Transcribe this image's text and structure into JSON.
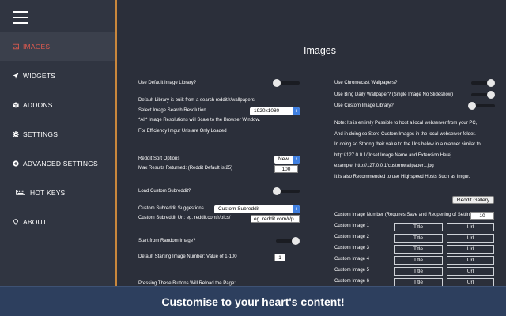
{
  "sidebar": {
    "items": [
      {
        "label": "IMAGES",
        "icon": "image-icon",
        "active": true
      },
      {
        "label": "WIDGETS",
        "icon": "paper-plane-icon"
      },
      {
        "label": "ADDONS",
        "icon": "cube-icon"
      },
      {
        "label": "SETTINGS",
        "icon": "gear-icon"
      },
      {
        "label": "ADVANCED SETTINGS",
        "icon": "plus-circle-icon"
      },
      {
        "label": "HOT KEYS",
        "icon": "keyboard-icon"
      },
      {
        "label": "ABOUT",
        "icon": "lightbulb-icon"
      }
    ]
  },
  "main": {
    "title": "Images",
    "left": {
      "default_library_label": "Use Default Image Library?",
      "default_library_on": false,
      "library_note": "Default Library is built from a search reddit/r/wallpapers",
      "resolution_label": "Select Image Search Resolution",
      "resolution_value": "1920x1080",
      "all_res_note": "*All* Image Resolutions will Scale to the Browser Window.",
      "imgur_note": "For Efficiency Imgur Urls are Only Loaded",
      "sort_label": "Reddit Sort Options",
      "sort_value": "New",
      "max_results_label": "Max Results Returned: (Reddit Default is 25)",
      "max_results_value": "100",
      "load_custom_label": "Load Custom Subreddit?",
      "load_custom_on": false,
      "suggestions_label": "Custom Subreddit Suggestions",
      "suggestions_value": "Custom Subreddit",
      "custom_url_label": "Custom Subreddit Url:  eg.  reddit.com/r/pics/",
      "custom_url_value": "eg. reddit.com/r/p",
      "random_label": "Start from Random Image?",
      "random_on": true,
      "start_number_label": "Default Starting Image Number: Value of 1-100",
      "start_number_value": "1",
      "cut_text": "Pressing These Buttons Will Reload the Page:"
    },
    "right": {
      "chromecast_label": "Use Chromecast Wallpapers?",
      "chromecast_on": true,
      "bing_label": "Use Bing Daily Wallpaper?   (Single Image No Slideshow)",
      "bing_on": true,
      "custom_lib_label": "Use Custom Image Library?",
      "custom_lib_on": false,
      "note1": "Note: Its is entirely Possible to host a local webserver from your PC,",
      "note2": "And in doing so Store Custom Images in the local webserver folder.",
      "note3": "In doing so Storing their value to the Urls below in a manner similar to:",
      "note4": "http://127.0.0.1/[Inset Image Name and Extension Here]",
      "note5": "example: http://127.0.0.1/customwallpaper1.jpg",
      "note6": "It is also Recommended to use Highspeed Hosts Such as Imgur.",
      "gallery_button": "Reddit Gallery",
      "custom_number_label": "Custom Image Number (Requires Save and Reopening of Settings)",
      "custom_number_value": "10",
      "rows": [
        {
          "label": "Custom Image 1",
          "title": "Title",
          "url": "Url"
        },
        {
          "label": "Custom Image 2",
          "title": "Title",
          "url": "Url"
        },
        {
          "label": "Custom Image 3",
          "title": "Title",
          "url": "Url"
        },
        {
          "label": "Custom Image 4",
          "title": "Title",
          "url": "Url"
        },
        {
          "label": "Custom Image 5",
          "title": "Title",
          "url": "Url"
        },
        {
          "label": "Custom Image 6",
          "title": "Title",
          "url": "Url"
        }
      ]
    }
  },
  "banner": {
    "text": "Customise to your heart's content!"
  },
  "colors": {
    "accent": "#c9873c",
    "active_text": "#e05a4f",
    "banner": "#2d3f5e",
    "select_arrow": "#3f7fe0"
  }
}
